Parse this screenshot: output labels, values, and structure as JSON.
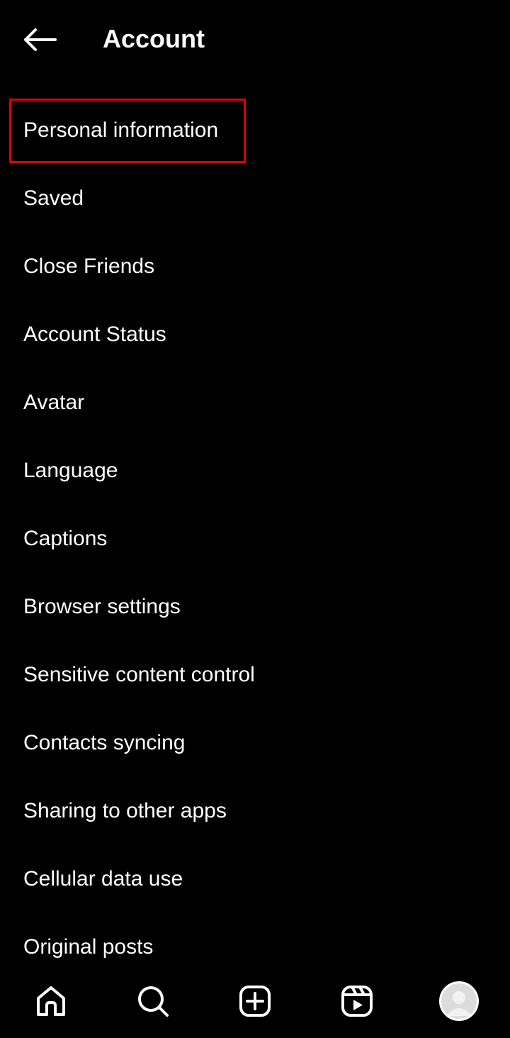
{
  "header": {
    "title": "Account",
    "back_icon": "arrow-left-icon"
  },
  "menu": {
    "items": [
      {
        "label": "Personal information",
        "highlighted": true
      },
      {
        "label": "Saved"
      },
      {
        "label": "Close Friends"
      },
      {
        "label": "Account Status"
      },
      {
        "label": "Avatar"
      },
      {
        "label": "Language"
      },
      {
        "label": "Captions"
      },
      {
        "label": "Browser settings"
      },
      {
        "label": "Sensitive content control"
      },
      {
        "label": "Contacts syncing"
      },
      {
        "label": "Sharing to other apps"
      },
      {
        "label": "Cellular data use"
      },
      {
        "label": "Original posts"
      }
    ]
  },
  "bottom_nav": {
    "items": [
      {
        "icon": "home-icon"
      },
      {
        "icon": "search-icon"
      },
      {
        "icon": "create-post-icon"
      },
      {
        "icon": "reels-icon"
      },
      {
        "icon": "profile-avatar"
      }
    ]
  },
  "colors": {
    "background": "#000000",
    "text": "#ffffff",
    "highlight": "#e00000"
  }
}
